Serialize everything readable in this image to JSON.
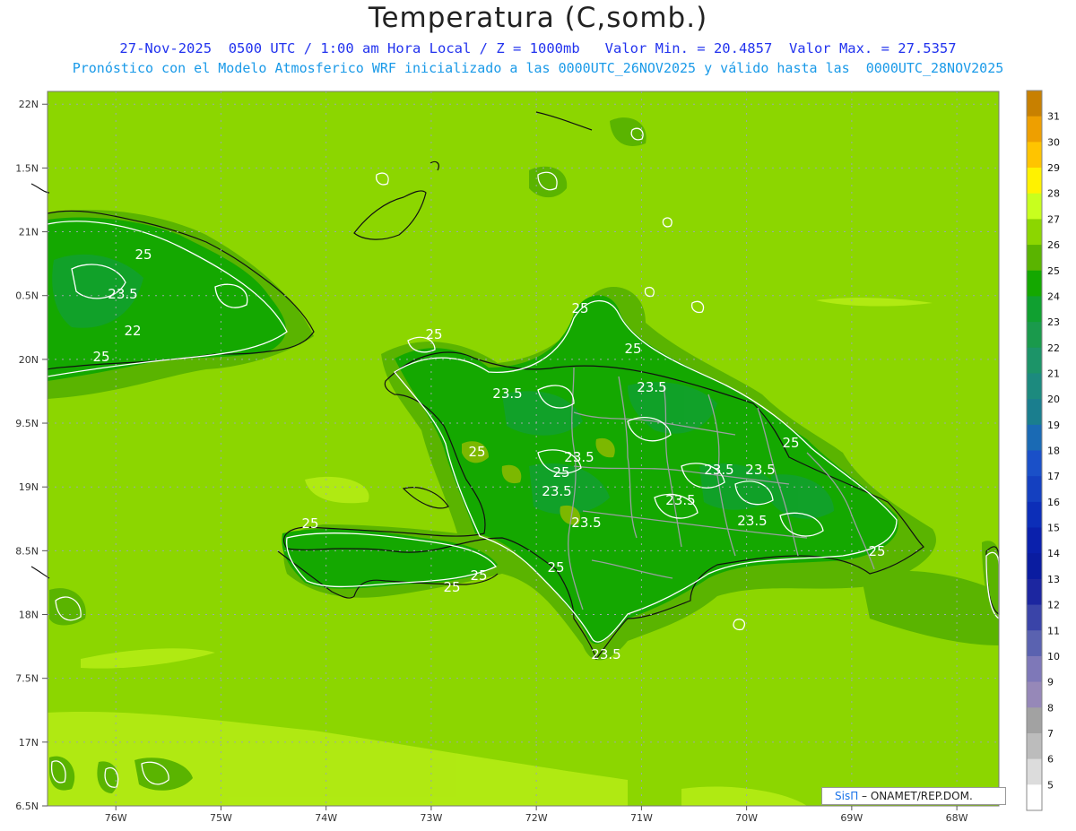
{
  "header": {
    "title": "Temperatura (C,somb.)",
    "subtitle_line1": "27-Nov-2025  0500 UTC / 1:00 am Hora Local / Z = 1000mb   Valor Min. = 20.4857  Valor Max. = 27.5357",
    "subtitle_line2": "Pronóstico con el Modelo Atmosferico WRF inicializado a las 0000UTC_26NOV2025 y válido hasta las  0000UTC_28NOV2025"
  },
  "map": {
    "lat_ticks": [
      "22N",
      "21.5N",
      "21N",
      "20.5N",
      "20N",
      "19.5N",
      "19N",
      "18.5N",
      "18N",
      "17.5N",
      "17N",
      "16.5N"
    ],
    "lat_tick_display": [
      "22N",
      "1.5N",
      "21N",
      "0.5N",
      "20N",
      "9.5N",
      "19N",
      "8.5N",
      "18N",
      "7.5N",
      "17N",
      "6.5N"
    ],
    "lon_ticks": [
      "76W",
      "75W",
      "74W",
      "73W",
      "72W",
      "71W",
      "70W",
      "69W",
      "68W"
    ],
    "lat_range": [
      16.5,
      22.1
    ],
    "lon_range": [
      -76.65,
      -67.6
    ],
    "contour_labels": [
      "25",
      "23.5",
      "22",
      "25",
      "23.5",
      "25",
      "25",
      "25",
      "23.5",
      "23.5",
      "25",
      "23.5",
      "23.5",
      "23.5",
      "25",
      "23.5",
      "23.5",
      "23.5",
      "25",
      "23.5",
      "25",
      "25",
      "25",
      "25",
      "25"
    ],
    "background_color": "#8cd600"
  },
  "colorbar": {
    "levels": [
      "31",
      "30",
      "29",
      "28",
      "27",
      "26",
      "25",
      "24",
      "23",
      "22",
      "21",
      "20",
      "19",
      "18",
      "17",
      "16",
      "15",
      "14",
      "13",
      "12",
      "11",
      "10",
      "9",
      "8",
      "7",
      "6",
      "5"
    ],
    "colors": [
      "#c88000",
      "#ee9f00",
      "#ffc400",
      "#fff200",
      "#c8ff1e",
      "#8cd600",
      "#5ab400",
      "#14a800",
      "#10a030",
      "#1a9a4c",
      "#1c9468",
      "#1c8a7e",
      "#1a7e8e",
      "#1a6ab4",
      "#1a50c8",
      "#1440c0",
      "#0c2eb8",
      "#0a20ac",
      "#0a1ca0",
      "#1c26a0",
      "#3a44a8",
      "#5a62b0",
      "#7e78b8",
      "#9688b8",
      "#a2a2a2",
      "#bcbcbc",
      "#dcdcdc",
      "#ffffff"
    ]
  },
  "credit": {
    "brand": "SisΠ",
    "text": " – ONAMET/REP.DOM."
  }
}
